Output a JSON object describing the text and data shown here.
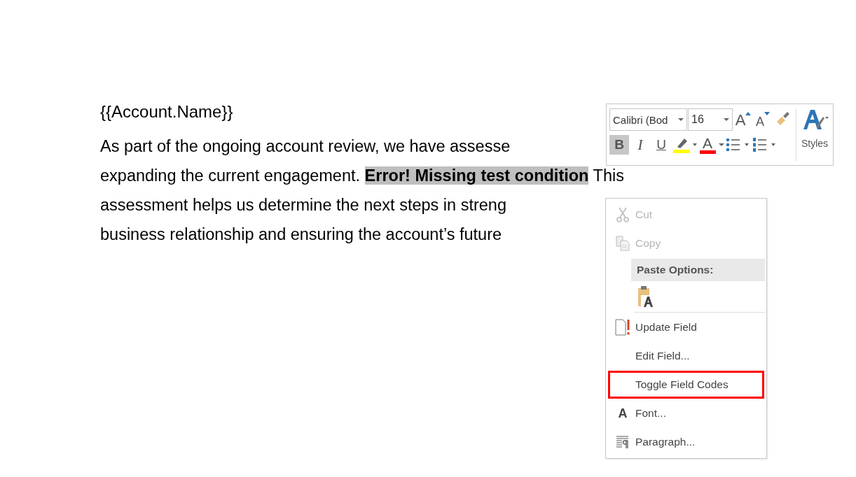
{
  "document": {
    "heading": "{{Account.Name}}",
    "lines": [
      {
        "text": "As part of the ongoing account review, we have assesse"
      },
      {
        "text": "expanding the current engagement. ",
        "field": "Error! Missing test condition",
        "after": " This"
      },
      {
        "text": "assessment helps us determine the next steps in streng"
      },
      {
        "text": "business relationship and ensuring the account’s future"
      }
    ]
  },
  "mini_toolbar": {
    "font_name": "Calibri (Bod",
    "font_size": "16",
    "row1": [
      {
        "kind": "grow",
        "glyph": "A"
      },
      {
        "kind": "shrink",
        "glyph": "A"
      },
      {
        "kind": "painter"
      }
    ],
    "row2": [
      {
        "kind": "bold",
        "glyph": "B",
        "selected": true
      },
      {
        "kind": "italic",
        "glyph": "I",
        "selected": false
      },
      {
        "kind": "underline",
        "glyph": "U",
        "selected": false
      },
      {
        "kind": "highlight",
        "color": "#ffff00"
      },
      {
        "kind": "fontcolor",
        "glyph": "A",
        "color": "#ff0000"
      },
      {
        "kind": "bullets"
      },
      {
        "kind": "numbering"
      }
    ],
    "styles_label": "Styles"
  },
  "context_menu": [
    {
      "kind": "cut",
      "label": "Cut",
      "disabled": true,
      "outlined": false
    },
    {
      "kind": "copy",
      "label": "Copy",
      "disabled": true,
      "outlined": false
    },
    {
      "kind": "header",
      "label": "Paste Options:"
    },
    {
      "kind": "paste"
    },
    {
      "kind": "update",
      "label": "Update Field",
      "disabled": false,
      "outlined": false
    },
    {
      "kind": "plain",
      "label": "Edit Field...",
      "disabled": false,
      "outlined": false
    },
    {
      "kind": "plain",
      "label": "Toggle Field Codes",
      "disabled": false,
      "outlined": true
    },
    {
      "kind": "font",
      "glyph": "A",
      "label": "Font...",
      "disabled": false,
      "outlined": false
    },
    {
      "kind": "paragraph",
      "label": "Paragraph...",
      "disabled": false,
      "outlined": false
    }
  ]
}
